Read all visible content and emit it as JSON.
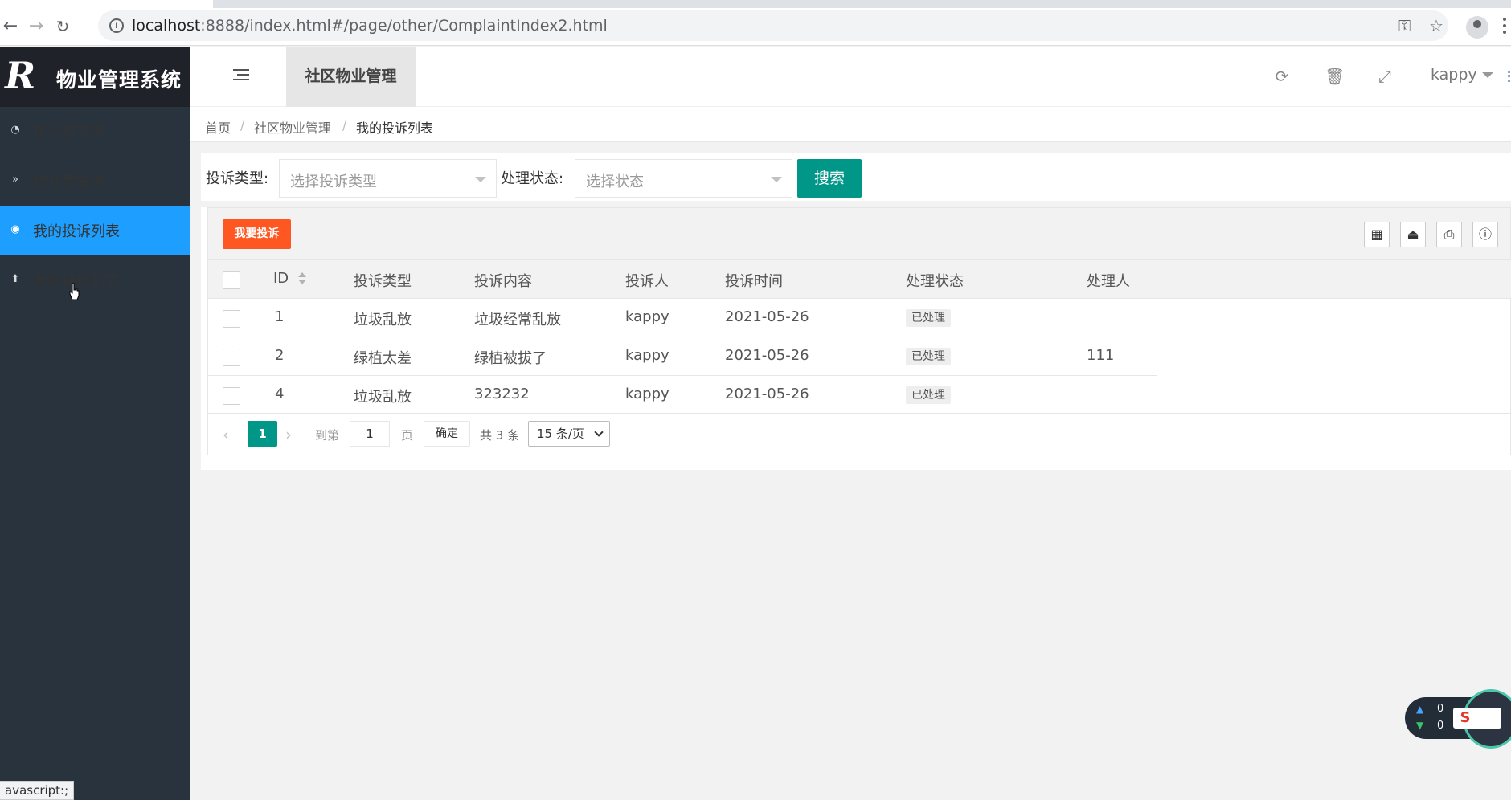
{
  "browser": {
    "url_host": "localhost",
    "url_path": ":8888/index.html#/page/other/ComplaintIndex2.html",
    "status_text": "avascript:;"
  },
  "app": {
    "title": "物业管理系统",
    "top_tab": "社区物业管理",
    "user": "kappy"
  },
  "sidebar": {
    "items": [
      {
        "label": "车位费查询",
        "icon": "dashboard-icon",
        "active": false
      },
      {
        "label": "物业费查询",
        "icon": "chevron-double-down-icon",
        "active": false
      },
      {
        "label": "我的投诉列表",
        "icon": "radio-dot-icon",
        "active": true
      },
      {
        "label": "我的保修列表",
        "icon": "up-arrow-circle-icon",
        "active": false
      }
    ]
  },
  "breadcrumb": [
    "首页",
    "社区物业管理",
    "我的投诉列表"
  ],
  "search": {
    "type_label": "投诉类型:",
    "type_placeholder": "选择投诉类型",
    "status_label": "处理状态:",
    "status_placeholder": "选择状态",
    "button": "搜索"
  },
  "toolbar": {
    "complain_button": "我要投诉"
  },
  "table": {
    "columns": [
      "ID",
      "投诉类型",
      "投诉内容",
      "投诉人",
      "投诉时间",
      "处理状态",
      "处理人"
    ],
    "rows": [
      {
        "id": "1",
        "type": "垃圾乱放",
        "content": "垃圾经常乱放",
        "user": "kappy",
        "time": "2021-05-26",
        "status": "已处理",
        "handler": ""
      },
      {
        "id": "2",
        "type": "绿植太差",
        "content": "绿植被拔了",
        "user": "kappy",
        "time": "2021-05-26",
        "status": "已处理",
        "handler": "111"
      },
      {
        "id": "4",
        "type": "垃圾乱放",
        "content": "323232",
        "user": "kappy",
        "time": "2021-05-26",
        "status": "已处理",
        "handler": ""
      }
    ]
  },
  "pager": {
    "current": "1",
    "goto_label": "到第",
    "goto_value": "1",
    "page_unit": "页",
    "confirm": "确定",
    "total": "共 3 条",
    "page_size": "15 条/页"
  },
  "widget": {
    "up_value": "0",
    "down_value": "0",
    "ime_glyph": "S"
  },
  "colors": {
    "sidebar_bg": "#28333e",
    "active_item": "#1e9fff",
    "primary": "#009688",
    "danger": "#ff5722"
  }
}
